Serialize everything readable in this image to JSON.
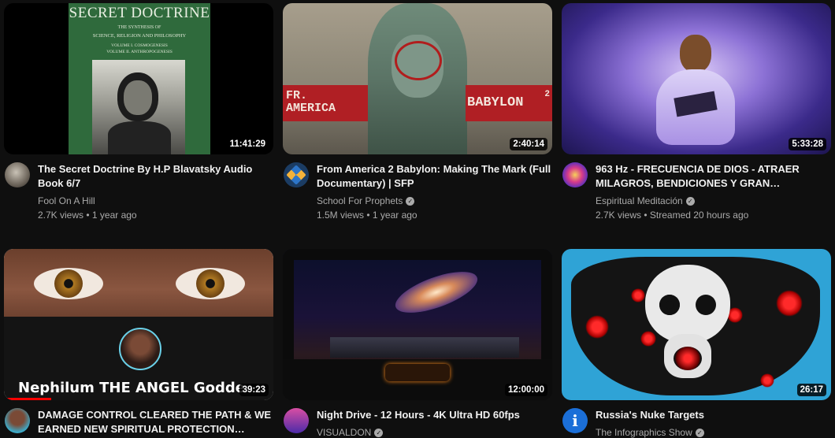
{
  "videos": [
    {
      "title": "The Secret Doctrine By H.P Blavatsky Audio Book 6/7",
      "channel": "Fool On A Hill",
      "verified": false,
      "stats": "2.7K views • 1 year ago",
      "duration": "11:41:29",
      "thumb_heading": "SECRET DOCTRINE",
      "thumb_sub1": "THE SYNTHESIS OF",
      "thumb_sub2": "SCIENCE, RELIGION AND PHILOSOPHY",
      "thumb_sub3": "VOLUME I. COSMOGENESIS",
      "thumb_sub4": "VOLUME II. ANTHROPOGENESIS"
    },
    {
      "title": "From America 2 Babylon: Making The Mark (Full Documentary) | SFP",
      "channel": "School For Prophets",
      "verified": true,
      "stats": "1.5M views • 1 year ago",
      "duration": "2:40:14",
      "thumb_left": "FR. AMERICA",
      "thumb_right": "BABYLON",
      "thumb_num": "2"
    },
    {
      "title": "963 Hz - FRECUENCIA DE DIOS - ATRAER MILAGROS, BENDICIONES Y GRAN…",
      "channel": "Espiritual Meditación",
      "verified": true,
      "stats": "2.7K views • Streamed 20 hours ago",
      "duration": "5:33:28"
    },
    {
      "title": "DAMAGE CONTROL CLEARED THE PATH & WE EARNED NEW SPIRITUAL PROTECTION…",
      "channel": "",
      "verified": false,
      "stats": "",
      "duration": "39:23",
      "thumb_caption": "Nephilum THE ANGEL Godde"
    },
    {
      "title": "Night Drive - 12 Hours - 4K Ultra HD 60fps",
      "channel": "VISUALDON",
      "verified": true,
      "stats": "",
      "duration": "12:00:00"
    },
    {
      "title": "Russia's Nuke Targets",
      "channel": "The Infographics Show",
      "verified": true,
      "stats": "",
      "duration": "26:17"
    }
  ]
}
